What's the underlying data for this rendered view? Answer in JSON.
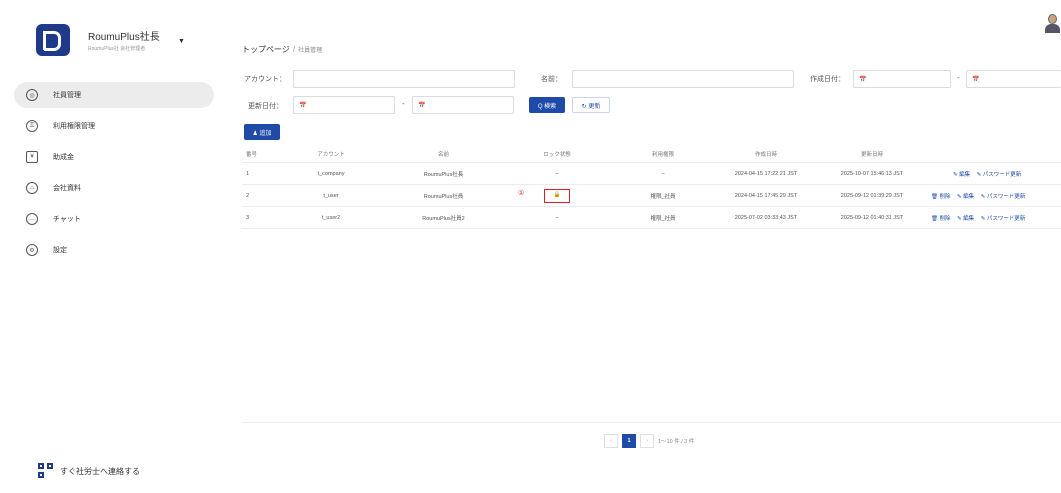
{
  "app": {
    "name": "RoumuPlus社長",
    "subtitle": "RoumuPlus社 会社管理者",
    "contact": "すぐ社労士へ連絡する"
  },
  "sidebar": {
    "items": [
      {
        "label": "社員管理",
        "icon": "user-circle-icon",
        "active": true
      },
      {
        "label": "利用権限管理",
        "icon": "shield-icon",
        "active": false
      },
      {
        "label": "助成金",
        "icon": "document-icon",
        "active": false
      },
      {
        "label": "会社資料",
        "icon": "building-icon",
        "active": false
      },
      {
        "label": "チャット",
        "icon": "chat-icon",
        "active": false
      },
      {
        "label": "設定",
        "icon": "gear-icon",
        "active": false
      }
    ]
  },
  "breadcrumb": {
    "home": "トップページ",
    "separator": "/",
    "current": "社員管理"
  },
  "filters": {
    "account_label": "アカウント：",
    "name_label": "名前：",
    "created_label": "作成日付：",
    "updated_label": "更新日付：",
    "date_placeholder": "📅",
    "range_sep": "-",
    "search_button": "Q 検索",
    "refresh_button": "↻ 更新",
    "add_button": "♟ 追加"
  },
  "table": {
    "headers": [
      "番号",
      "アカウント",
      "名前",
      "ロック状態",
      "利用権限",
      "作成日時",
      "更新日時",
      ""
    ],
    "rows": [
      {
        "no": "1",
        "account": "t_company",
        "name": "RoumuPlus社長",
        "lock": "–",
        "role": "–",
        "created": "2024-04-15 17:22:21 JST",
        "updated": "2025-10-07 15:46:13 JST",
        "actions": [
          "✎ 編集",
          "✎ パスワード更新"
        ]
      },
      {
        "no": "2",
        "account": "t_user",
        "name": "RoumuPlus社員",
        "lock": "🔒",
        "role": "権限_社員",
        "created": "2024-04-15 17:45:29 JST",
        "updated": "2025-09-12 01:39:29 JST",
        "actions": [
          "🗑 削除",
          "✎ 編集",
          "✎ パスワード更新"
        ]
      },
      {
        "no": "3",
        "account": "t_user2",
        "name": "RoumuPlus社員2",
        "lock": "–",
        "role": "権限_社員",
        "created": "2025-07-02 03:33:43 JST",
        "updated": "2025-09-12 01:40:31 JST",
        "actions": [
          "🗑 削除",
          "✎ 編集",
          "✎ パスワード更新"
        ]
      }
    ],
    "marker": "①"
  },
  "pagination": {
    "prev": "‹",
    "current": "1",
    "next": "›",
    "info": "1〜10 件 / 3 件"
  },
  "colors": {
    "primary": "#1f4aa8",
    "highlight": "#e02020"
  }
}
